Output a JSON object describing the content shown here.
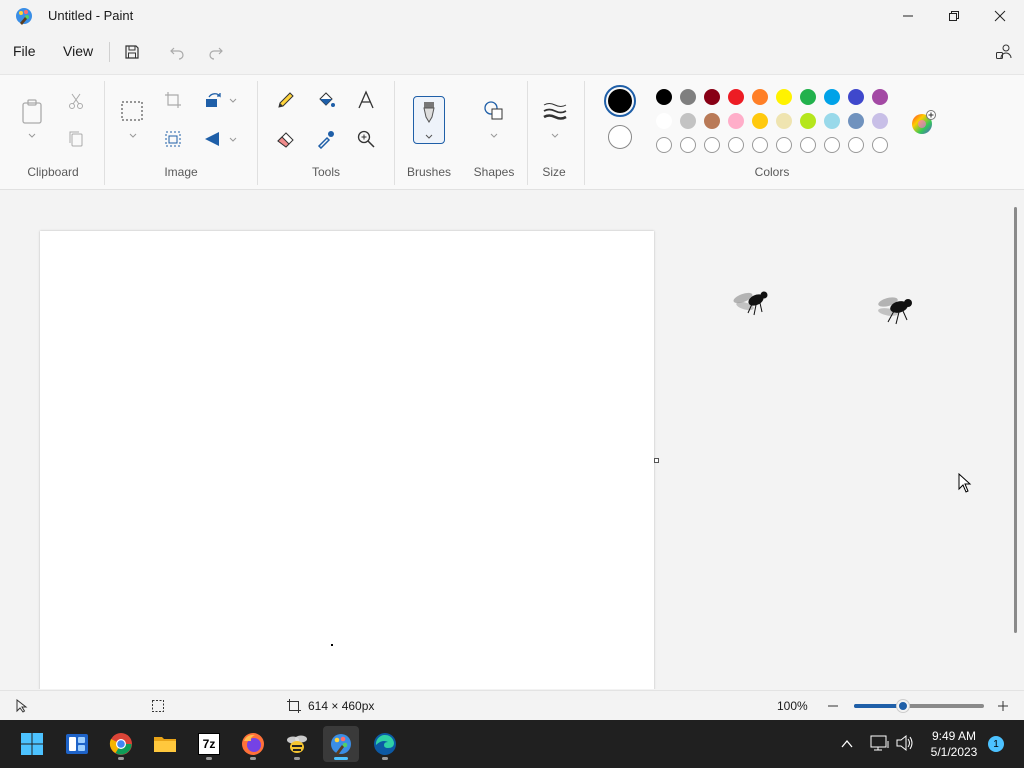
{
  "window": {
    "title": "Untitled - Paint"
  },
  "menu": {
    "file_label": "File",
    "view_label": "View"
  },
  "ribbon": {
    "groups": {
      "clipboard": "Clipboard",
      "image": "Image",
      "tools": "Tools",
      "brushes": "Brushes",
      "shapes": "Shapes",
      "size": "Size",
      "colors": "Colors"
    }
  },
  "colors": {
    "primary": "#000000",
    "secondary": "#ffffff",
    "row1": [
      "#000000",
      "#7f7f7f",
      "#880015",
      "#ed1c24",
      "#ff7f27",
      "#fff200",
      "#22b14c",
      "#00a2e8",
      "#3f48cc",
      "#a349a4"
    ],
    "row2": [
      "#ffffff",
      "#c3c3c3",
      "#b97a57",
      "#ffaec9",
      "#ffc90e",
      "#efe4b0",
      "#b5e61d",
      "#99d9ea",
      "#7092be",
      "#c8bfe7"
    ],
    "row3_empty": 10
  },
  "status": {
    "canvas_size": "614 × 460px",
    "zoom": "100%",
    "zoom_slider_fraction": 0.38
  },
  "taskbar": {
    "apps": [
      "start-icon",
      "widgets-icon",
      "chrome-icon",
      "file-explorer-icon",
      "7zip-icon",
      "firefox-icon",
      "bee-app-icon",
      "paint-icon",
      "edge-icon"
    ],
    "seven_zip_label": "7z",
    "time": "9:49 AM",
    "date": "5/1/2023",
    "notification_count": "1"
  }
}
